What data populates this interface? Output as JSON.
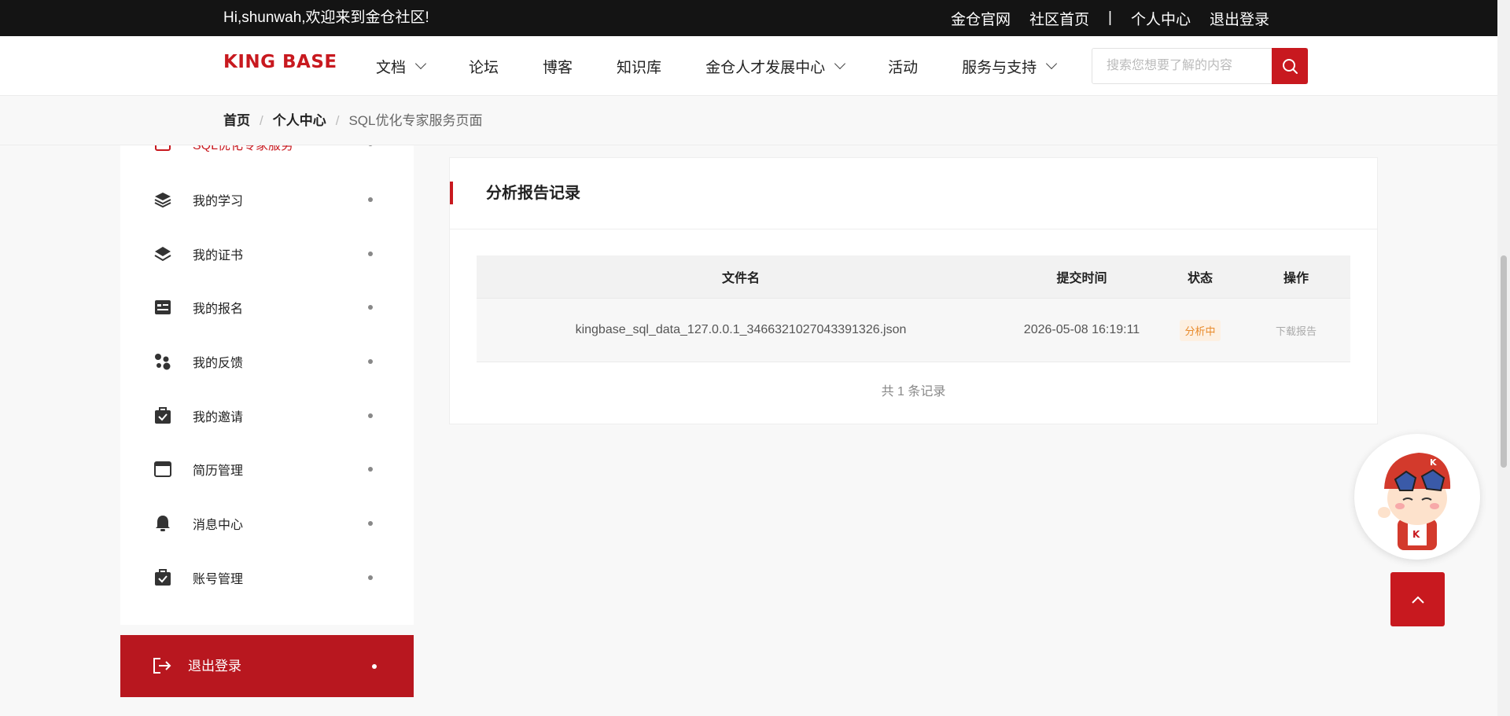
{
  "topbar": {
    "greeting": "Hi,shunwah,欢迎来到金仓社区!",
    "links": [
      "金仓官网",
      "社区首页",
      "|",
      "个人中心",
      "退出登录"
    ]
  },
  "header": {
    "logo": "KING BASE",
    "nav": [
      {
        "label": "文档",
        "dropdown": true
      },
      {
        "label": "论坛",
        "dropdown": false
      },
      {
        "label": "博客",
        "dropdown": false
      },
      {
        "label": "知识库",
        "dropdown": false
      },
      {
        "label": "金仓人才发展中心",
        "dropdown": true
      },
      {
        "label": "活动",
        "dropdown": false
      },
      {
        "label": "服务与支持",
        "dropdown": true
      }
    ],
    "search_placeholder": "搜索您想要了解的内容"
  },
  "breadcrumb": {
    "home": "首页",
    "sep": "/",
    "center": "个人中心",
    "current": "SQL优化专家服务页面"
  },
  "sidebar": {
    "items": [
      {
        "label": "SQL优化专家服务",
        "icon": "sql-icon",
        "active": true
      },
      {
        "label": "我的学习",
        "icon": "layers-icon"
      },
      {
        "label": "我的证书",
        "icon": "layers-icon"
      },
      {
        "label": "我的报名",
        "icon": "form-icon"
      },
      {
        "label": "我的反馈",
        "icon": "feedback-icon"
      },
      {
        "label": "我的邀请",
        "icon": "briefcase-icon"
      },
      {
        "label": "简历管理",
        "icon": "window-icon"
      },
      {
        "label": "消息中心",
        "icon": "bell-icon"
      },
      {
        "label": "账号管理",
        "icon": "briefcase-icon"
      }
    ],
    "logout": "退出登录"
  },
  "main": {
    "title": "分析报告记录",
    "columns": [
      "文件名",
      "提交时间",
      "状态",
      "操作"
    ],
    "rows": [
      {
        "filename": "kingbase_sql_data_127.0.0.1_3466321027043391326.json",
        "time": "2026-05-08 16:19:11",
        "status": "分析中",
        "action": "下载报告"
      }
    ],
    "total": "共 1 条记录"
  },
  "colors": {
    "accent": "#c8191f",
    "topbar": "#141414",
    "status_text": "#e98a2a"
  }
}
